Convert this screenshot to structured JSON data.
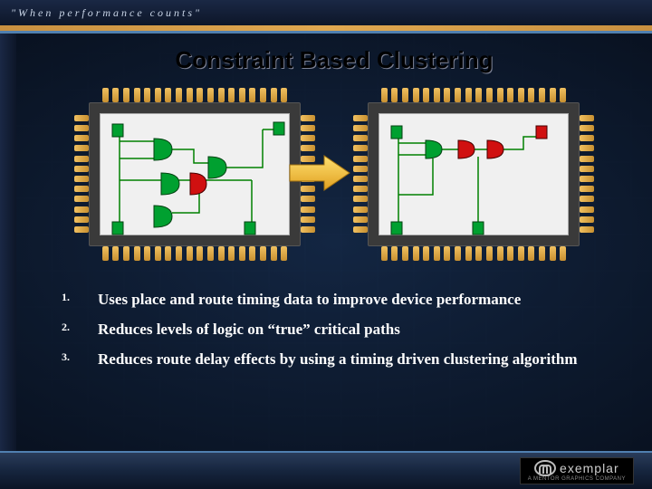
{
  "header": {
    "tagline": "\"When performance counts\""
  },
  "title": "Constraint Based Clustering",
  "bullets": [
    {
      "num": "1.",
      "text": "Uses place and route timing data to improve device performance"
    },
    {
      "num": "2.",
      "text": "Reduces levels of logic on “true” critical paths"
    },
    {
      "num": "3.",
      "text": "Reduces route delay effects by using a timing driven clustering algorithm"
    }
  ],
  "figure": {
    "left_chip": "chip-before",
    "right_chip": "chip-after",
    "arrow": "transform-arrow"
  },
  "footer": {
    "logo_text": "exemplar",
    "logo_subtext": "A MENTOR GRAPHICS COMPANY"
  },
  "colors": {
    "pin": "#e0a850",
    "gate_green": "#00a030",
    "gate_red": "#d01010",
    "net": "#008000"
  }
}
